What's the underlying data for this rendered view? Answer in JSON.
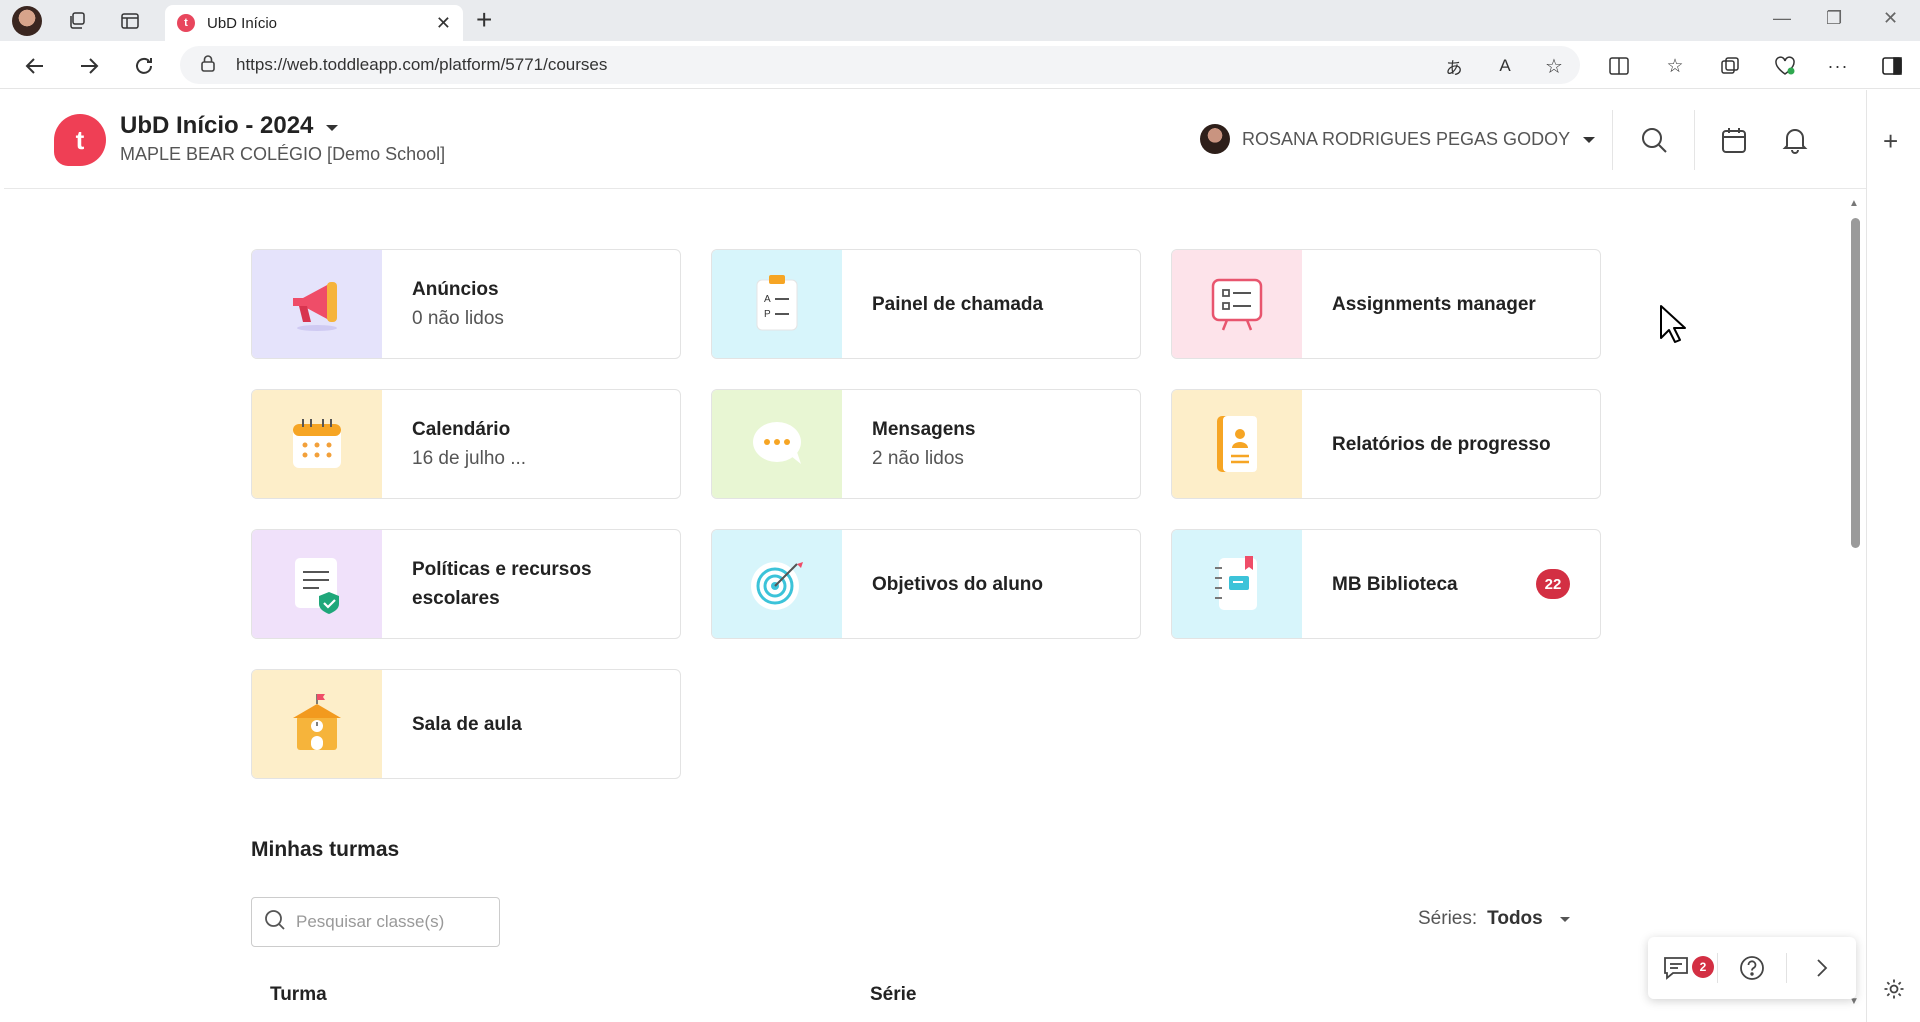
{
  "browser": {
    "tab_title": "UbD Início",
    "tab_favicon": "t",
    "url": "https://web.toddleapp.com/platform/5771/courses"
  },
  "header": {
    "logo_letter": "t",
    "title": "UbD Início - 2024",
    "school": "MAPLE BEAR COLÉGIO [Demo School]",
    "user_name": "ROSANA RODRIGUES PEGAS GODOY"
  },
  "cards": [
    {
      "title": "Anúncios",
      "subtitle": "0 não lidos",
      "icon": "megaphone-icon",
      "bg": "#e5e3fb"
    },
    {
      "title": "Painel de chamada",
      "subtitle": "",
      "icon": "attendance-clipboard-icon",
      "bg": "#d7f5fb"
    },
    {
      "title": "Assignments manager",
      "subtitle": "",
      "icon": "assignment-board-icon",
      "bg": "#fde3ea"
    },
    {
      "title": "Calendário",
      "subtitle": "16 de julho ...",
      "icon": "calendar-icon",
      "bg": "#fdeec9"
    },
    {
      "title": "Mensagens",
      "subtitle": "2 não lidos",
      "icon": "chat-bubble-icon",
      "bg": "#e8f6d3"
    },
    {
      "title": "Relatórios de progresso",
      "subtitle": "",
      "icon": "report-book-icon",
      "bg": "#fdeec9"
    },
    {
      "title": "Políticas e recursos escolares",
      "subtitle": "",
      "icon": "policy-document-icon",
      "bg": "#f0e1fa"
    },
    {
      "title": "Objetivos do aluno",
      "subtitle": "",
      "icon": "target-icon",
      "bg": "#d7f5fb"
    },
    {
      "title": "MB Biblioteca",
      "subtitle": "",
      "icon": "notebook-icon",
      "bg": "#d7f5fb",
      "badge": "22"
    },
    {
      "title": "Sala de aula",
      "subtitle": "",
      "icon": "school-building-icon",
      "bg": "#fdeec9"
    }
  ],
  "classes": {
    "section_title": "Minhas turmas",
    "search_placeholder": "Pesquisar classe(s)",
    "series_label": "Séries:",
    "series_value": "Todos",
    "columns": [
      "Turma",
      "Série"
    ]
  },
  "help_widget": {
    "chat_badge": "2"
  }
}
